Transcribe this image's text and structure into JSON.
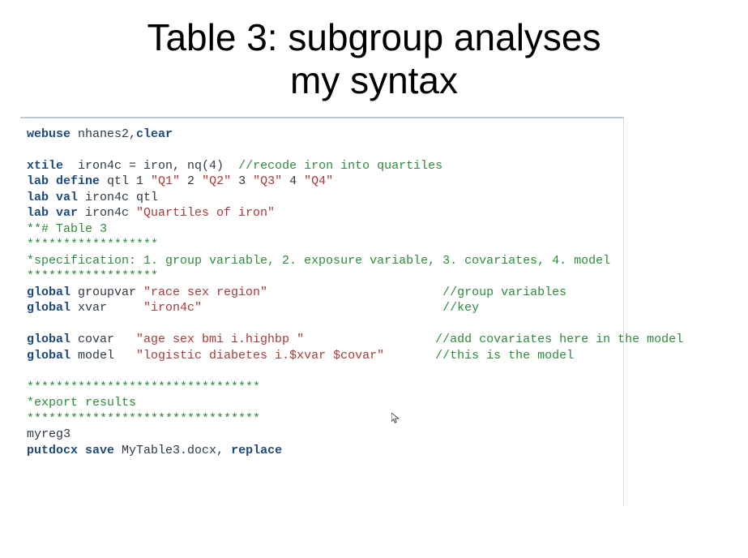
{
  "title_line1": "Table 3: subgroup analyses",
  "title_line2": "my syntax",
  "code": {
    "l1": {
      "kw": "webuse",
      "arg": " nhanes2,",
      "kw2": "clear"
    },
    "l2": {
      "kw": "xtile",
      "arg": "  iron4c = iron, nq(4)  ",
      "cmt": "//recode iron into quartiles"
    },
    "l3": {
      "kw": "lab define",
      "arg": " qtl 1 ",
      "s1": "\"Q1\"",
      "arg2": " 2 ",
      "s2": "\"Q2\"",
      "arg3": " 3 ",
      "s3": "\"Q3\"",
      "arg4": " 4 ",
      "s4": "\"Q4\""
    },
    "l4": {
      "kw": "lab val",
      "arg": " iron4c qtl"
    },
    "l5": {
      "kw": "lab var",
      "arg": " iron4c ",
      "s1": "\"Quartiles of iron\""
    },
    "l6": {
      "cmt": "**# Table 3"
    },
    "l7": {
      "cmt": "******************"
    },
    "l8": {
      "cmt": "*specification: 1. group variable, 2. exposure variable, 3. covariates, 4. model"
    },
    "l9": {
      "cmt": "******************"
    },
    "l10": {
      "kw": "global",
      "arg": " groupvar ",
      "s1": "\"race sex region\"",
      "pad": "                        ",
      "cmt": "//group variables"
    },
    "l11": {
      "kw": "global",
      "arg": " xvar     ",
      "s1": "\"iron4c\"",
      "pad": "                                 ",
      "cmt": "//key"
    },
    "l12": {
      "kw": "global",
      "arg": " covar   ",
      "s1": "\"age sex bmi i.highbp \"",
      "pad": "                  ",
      "cmt": "//add covariates here in the model"
    },
    "l13": {
      "kw": "global",
      "arg": " model   ",
      "s1": "\"logistic diabetes i.$xvar $covar\"",
      "pad": "       ",
      "cmt": "//this is the model"
    },
    "l14": {
      "cmt": "********************************"
    },
    "l15": {
      "cmt": "*export results"
    },
    "l16": {
      "cmt": "********************************"
    },
    "l17": {
      "arg": "myreg3"
    },
    "l18": {
      "kw": "putdocx save",
      "arg": " MyTable3.docx, ",
      "kw2": "replace"
    }
  }
}
